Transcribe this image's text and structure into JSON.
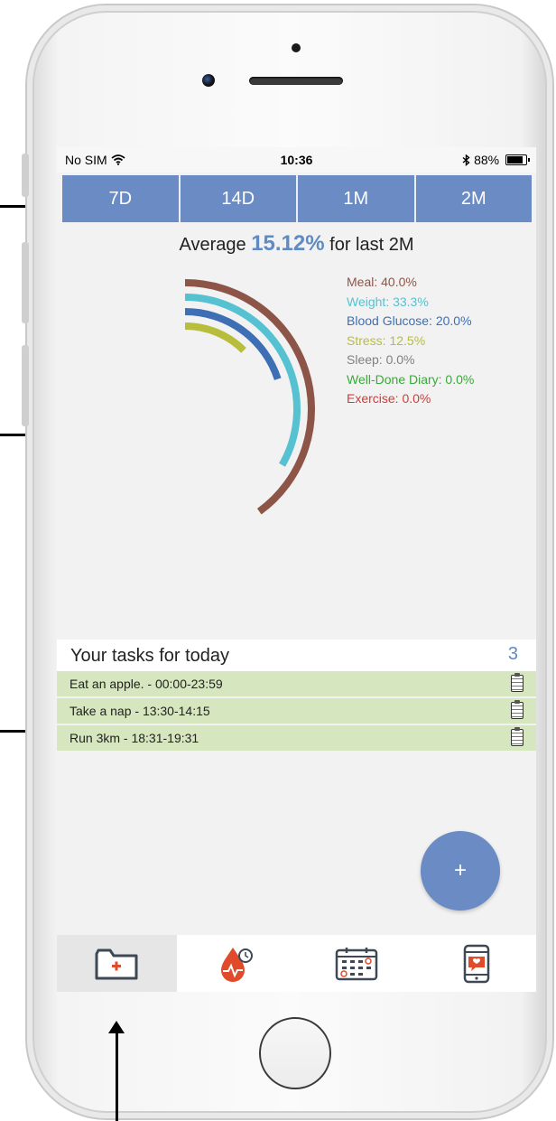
{
  "status_bar": {
    "carrier": "No SIM",
    "time": "10:36",
    "battery": "88%"
  },
  "range_tabs": [
    "7D",
    "14D",
    "1M",
    "2M"
  ],
  "average": {
    "prefix": "Average",
    "value": "15.12%",
    "suffix": "for last 2M"
  },
  "legend": [
    {
      "label": "Meal: 40.0%",
      "color": "#8c5548",
      "value": 40.0
    },
    {
      "label": "Weight: 33.3%",
      "color": "#56c1d1",
      "value": 33.3
    },
    {
      "label": "Blood Glucose: 20.0%",
      "color": "#3e6fb5",
      "value": 20.0
    },
    {
      "label": "Stress: 12.5%",
      "color": "#b8bd3c",
      "value": 12.5
    },
    {
      "label": "Sleep: 0.0%",
      "color": "#808080",
      "value": 0.0
    },
    {
      "label": "Well-Done Diary: 0.0%",
      "color": "#3aa83a",
      "value": 0.0
    },
    {
      "label": "Exercise: 0.0%",
      "color": "#d23b3b",
      "value": 0.0
    }
  ],
  "tasks": {
    "title": "Your tasks for today",
    "count": "3",
    "items": [
      "Eat an apple. - 00:00-23:59",
      "Take a nap - 13:30-14:15",
      "Run 3km - 18:31-19:31"
    ]
  },
  "fab_label": "+",
  "tab_bar": [
    "medical-folder-icon",
    "blood-drop-timer-icon",
    "calendar-icon",
    "phone-chat-icon"
  ],
  "colors": {
    "accent": "#6a8bc4",
    "task_bg": "#d6e6bf"
  }
}
